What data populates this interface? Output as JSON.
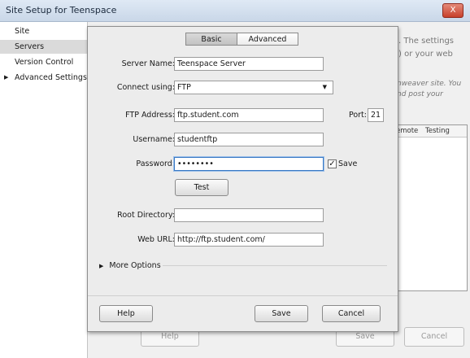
{
  "window": {
    "title": "Site Setup for Teenspace",
    "close_label": "X"
  },
  "sidebar": {
    "items": [
      {
        "label": "Site"
      },
      {
        "label": "Servers"
      },
      {
        "label": "Version Control"
      },
      {
        "label": "Advanced Settings",
        "expand_glyph": "▶"
      }
    ]
  },
  "background": {
    "text_line1": ". The settings",
    "text_line2": ") or your web",
    "text_italic1": "nweaver site. You",
    "text_italic2": "nd post your",
    "col_remote": "emote",
    "col_testing": "Testing",
    "help_label": "Help",
    "save_label": "Save",
    "cancel_label": "Cancel"
  },
  "dialog": {
    "tabs": [
      {
        "label": "Basic"
      },
      {
        "label": "Advanced"
      }
    ],
    "server_name": {
      "label": "Server Name:",
      "value": "Teenspace Server"
    },
    "connect_using": {
      "label": "Connect using:",
      "value": "FTP",
      "caret": "▼"
    },
    "ftp_address": {
      "label": "FTP Address:",
      "value": "ftp.student.com"
    },
    "port": {
      "label": "Port:",
      "value": "21"
    },
    "username": {
      "label": "Username:",
      "value": "studentftp"
    },
    "password": {
      "label": "Password:",
      "value": "••••••••"
    },
    "save_password": {
      "label": "Save",
      "check": "✓"
    },
    "test_label": "Test",
    "root_directory": {
      "label": "Root Directory:",
      "value": ""
    },
    "web_url": {
      "label": "Web URL:",
      "value": "http://ftp.student.com/"
    },
    "more_options": {
      "label": "More Options",
      "glyph": "▶"
    },
    "help_label": "Help",
    "save_label": "Save",
    "cancel_label": "Cancel"
  }
}
